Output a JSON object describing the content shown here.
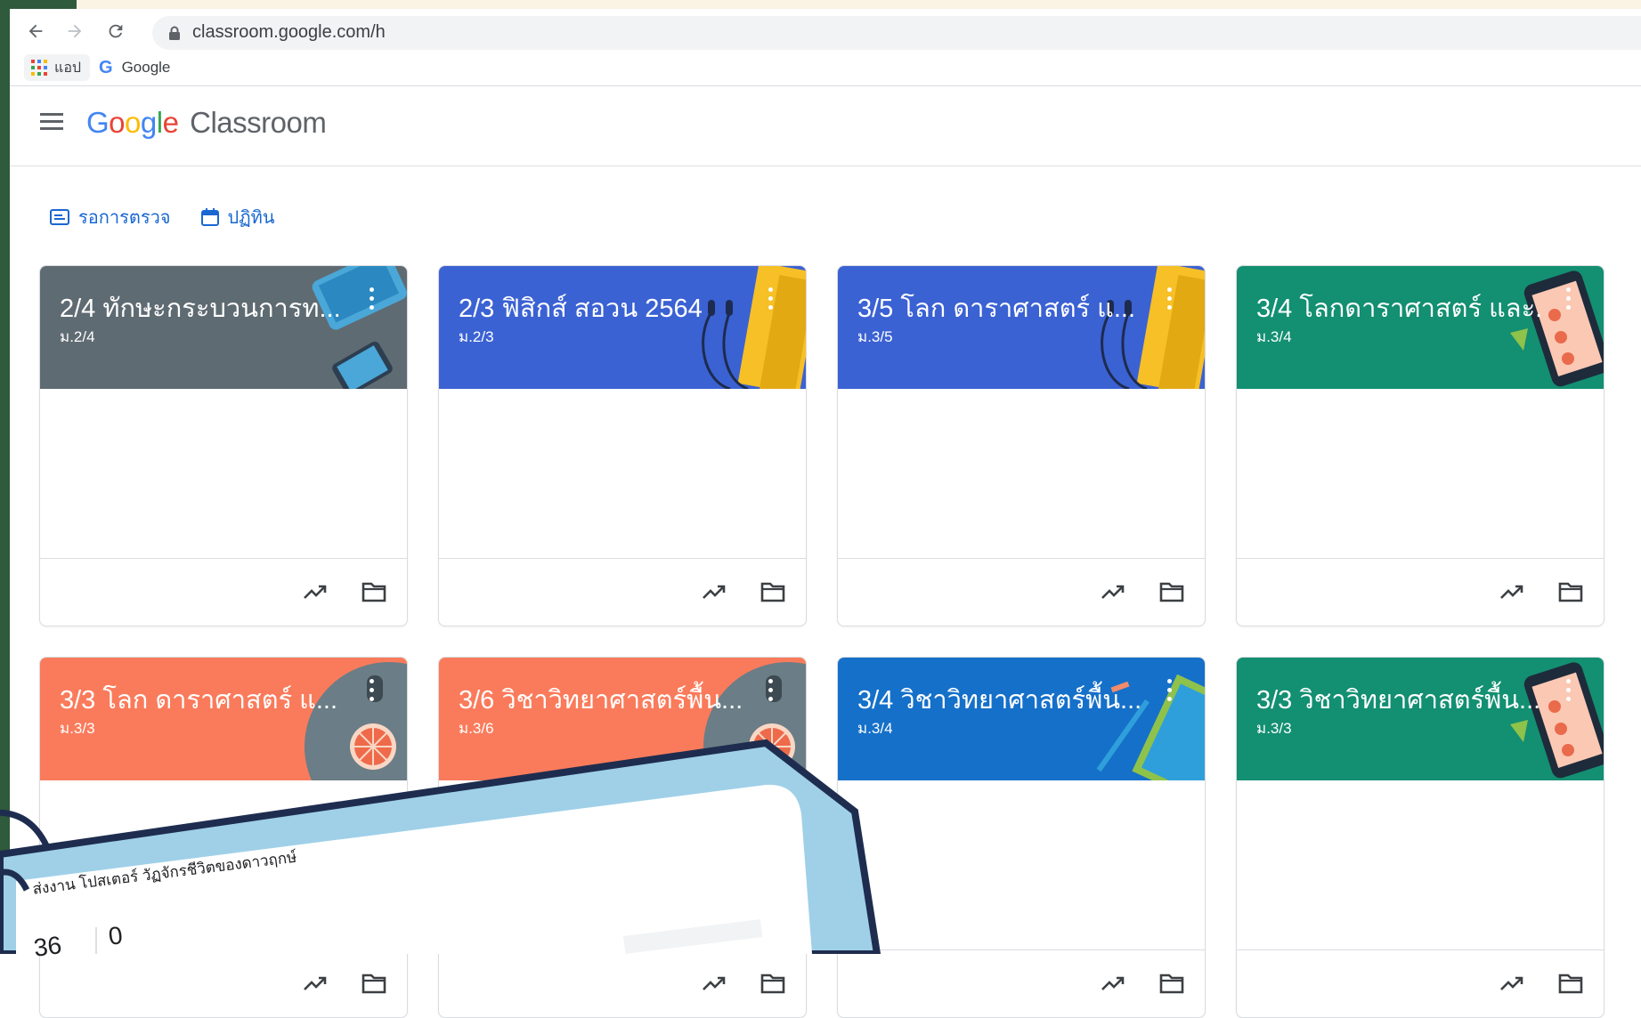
{
  "browser": {
    "url": "classroom.google.com/h",
    "bookmarks": [
      {
        "label": "แอป",
        "icon": "apps-grid-icon"
      },
      {
        "label": "Google",
        "icon": "google-g-icon"
      }
    ]
  },
  "header": {
    "brand_google": [
      "G",
      "o",
      "o",
      "g",
      "l",
      "e"
    ],
    "brand_product": "Classroom"
  },
  "quicklinks": [
    {
      "label": "รอการตรวจ",
      "icon": "to-review-icon"
    },
    {
      "label": "ปฏิทิน",
      "icon": "calendar-icon"
    }
  ],
  "classes": [
    {
      "title": "2/4 ทักษะกระบวนการท...",
      "section": "ม.2/4",
      "color": "#5f6b72",
      "art": "tablets"
    },
    {
      "title": "2/3 ฟิสิกส์ สอวน 2564",
      "section": "ม.2/3",
      "color": "#3b62d3",
      "art": "notebook"
    },
    {
      "title": "3/5 โลก ดาราศาสตร์ แ...",
      "section": "ม.3/5",
      "color": "#3b62d3",
      "art": "notebook"
    },
    {
      "title": "3/4 โลกดาราศาสตร์ และ...",
      "section": "ม.3/4",
      "color": "#138f72",
      "art": "phone"
    },
    {
      "title": "3/3 โลก ดาราศาสตร์ แ...",
      "section": "ม.3/3",
      "color": "#fa7b5b",
      "art": "citrus"
    },
    {
      "title": "3/6 วิชาวิทยาศาสตร์พื้น...",
      "section": "ม.3/6",
      "color": "#fa7b5b",
      "art": "citrus"
    },
    {
      "title": "3/4 วิชาวิทยาศาสตร์พื้น...",
      "section": "ม.3/4",
      "color": "#1570c9",
      "art": "pencil"
    },
    {
      "title": "3/3 วิชาวิทยาศาสตร์พื้น...",
      "section": "ม.3/3",
      "color": "#138f72",
      "art": "phone"
    }
  ],
  "card_footer_icons": [
    "trending-up-icon",
    "folder-icon"
  ],
  "overlay": {
    "assignment_text": "ส่งงาน โปสเตอร์ วัฏจักรชีวิตของดาวฤกษ์",
    "count_a": "36",
    "count_b": "0",
    "colors": {
      "panel": "#9fd0e8",
      "outline": "#1e2d4f"
    }
  }
}
